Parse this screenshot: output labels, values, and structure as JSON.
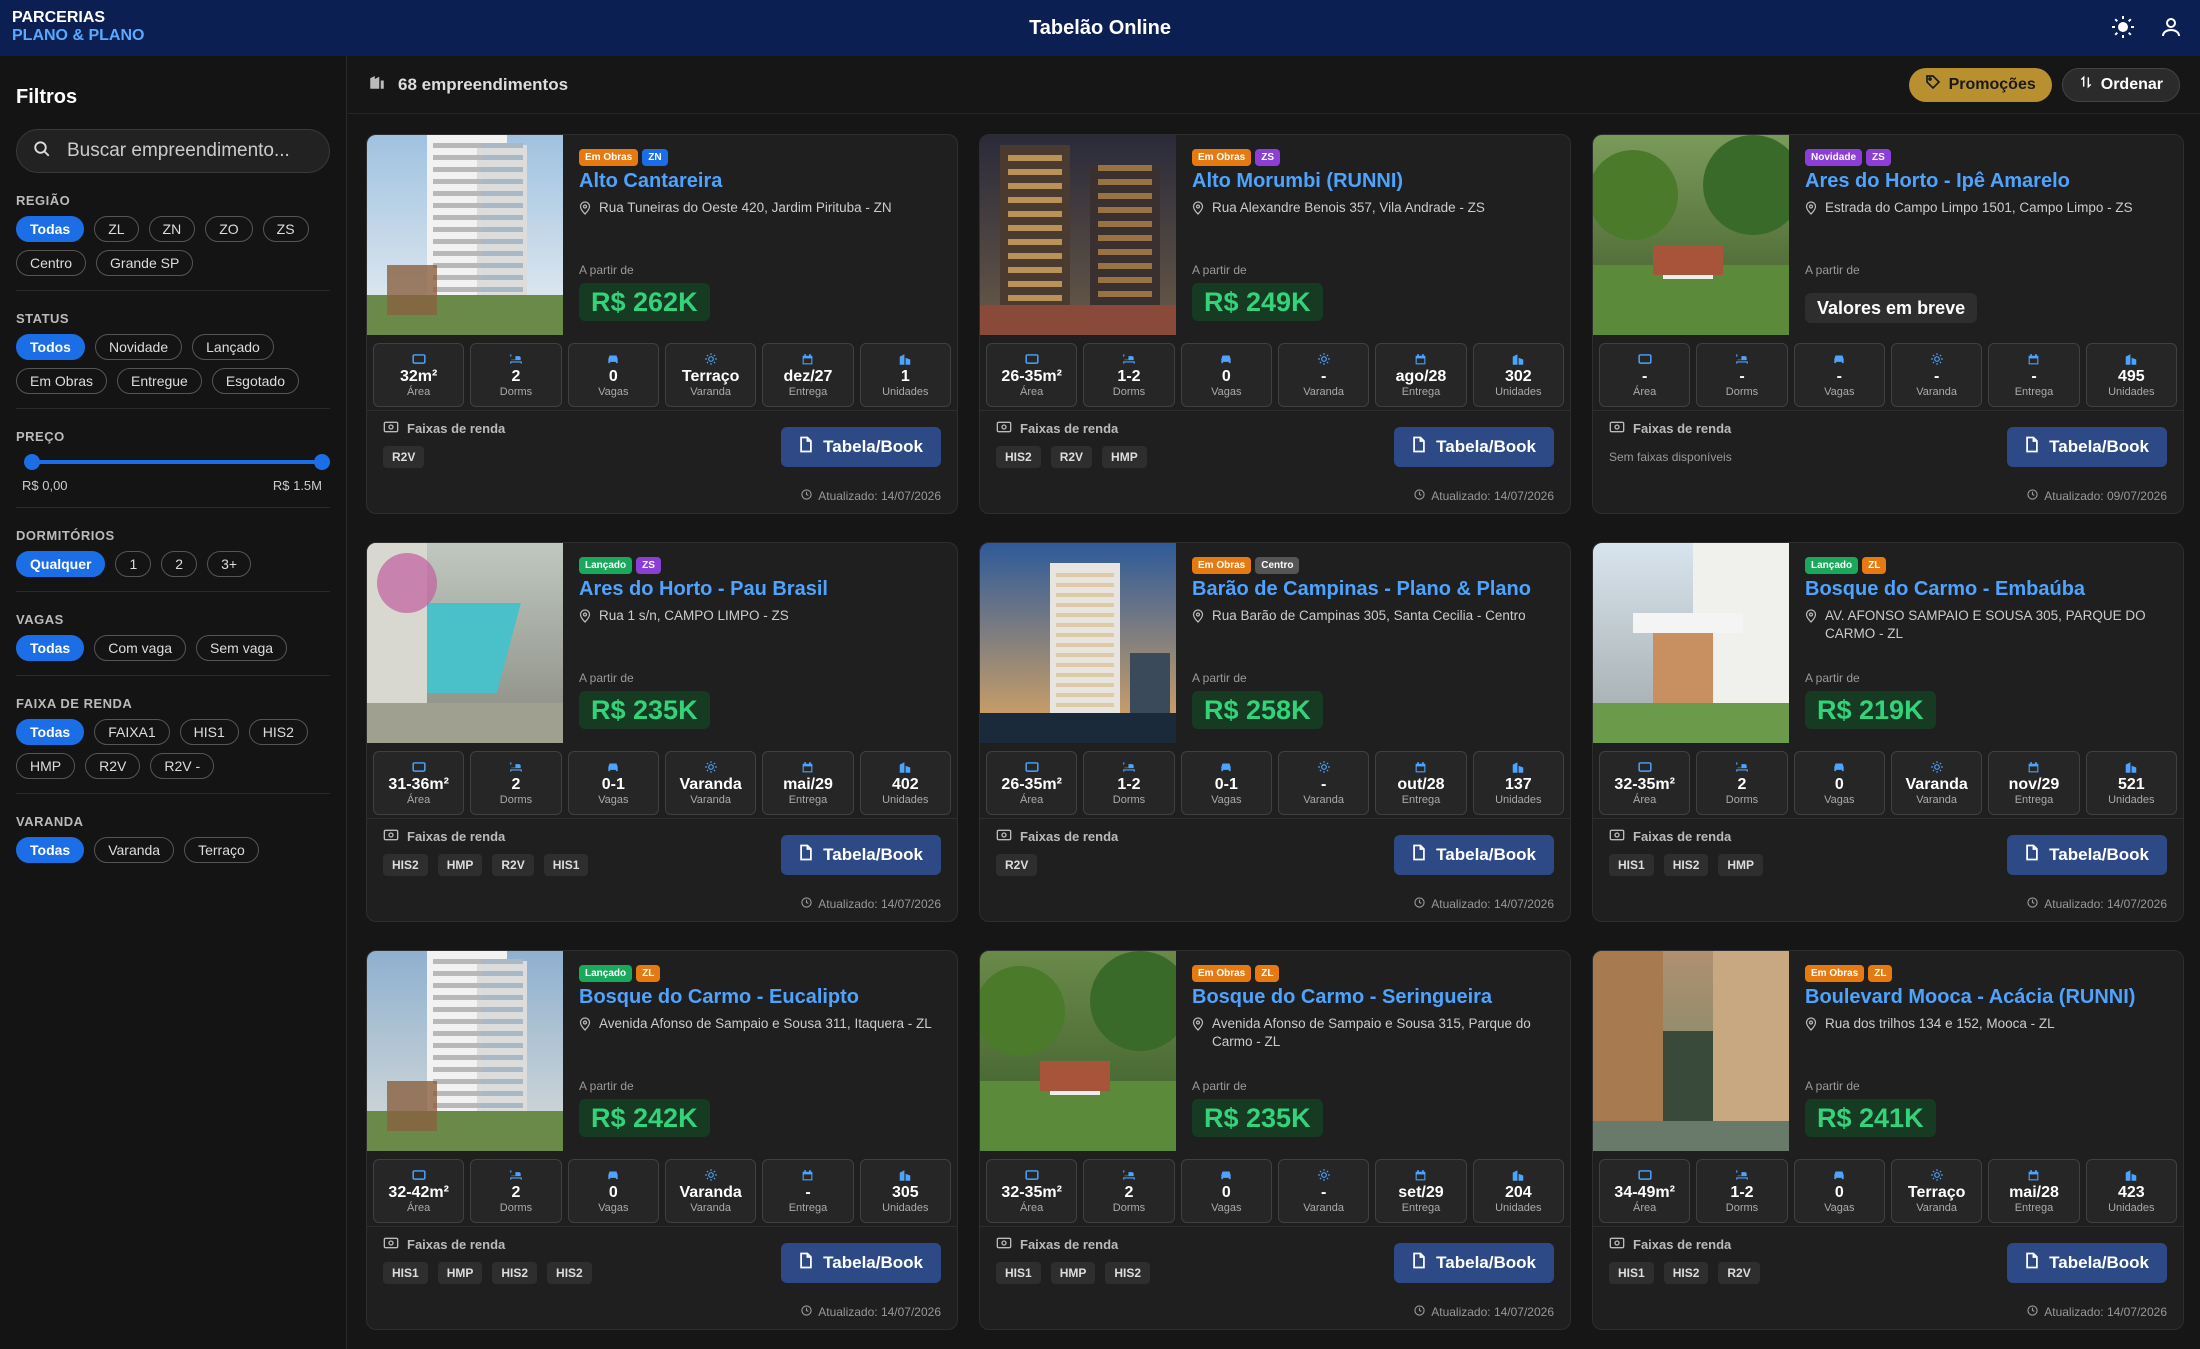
{
  "header": {
    "brand_line1": "PARCERIAS",
    "brand_line2": "PLANO & PLANO",
    "title": "Tabelão Online"
  },
  "sidebar": {
    "title": "Filtros",
    "search_placeholder": "Buscar empreendimento...",
    "groups": [
      {
        "label": "REGIÃO",
        "chips": [
          "Todas",
          "ZL",
          "ZN",
          "ZO",
          "ZS",
          "Centro",
          "Grande SP"
        ],
        "active": 0
      },
      {
        "label": "STATUS",
        "chips": [
          "Todos",
          "Novidade",
          "Lançado",
          "Em Obras",
          "Entregue",
          "Esgotado"
        ],
        "active": 0
      },
      {
        "label": "PREÇO",
        "min": "R$ 0,00",
        "max": "R$ 1.5M"
      },
      {
        "label": "DORMITÓRIOS",
        "chips": [
          "Qualquer",
          "1",
          "2",
          "3+"
        ],
        "active": 0
      },
      {
        "label": "VAGAS",
        "chips": [
          "Todas",
          "Com vaga",
          "Sem vaga"
        ],
        "active": 0
      },
      {
        "label": "FAIXA DE RENDA",
        "chips": [
          "Todas",
          "FAIXA1",
          "HIS1",
          "HIS2",
          "HMP",
          "R2V",
          "R2V -"
        ],
        "active": 0
      },
      {
        "label": "VARANDA",
        "chips": [
          "Todas",
          "Varanda",
          "Terraço"
        ],
        "active": 0
      }
    ]
  },
  "toolbar": {
    "count": "68 empreendimentos",
    "promo": "Promoções",
    "order": "Ordenar"
  },
  "labels": {
    "from": "A partir de",
    "faixas": "Faixas de renda",
    "book": "Tabela/Book",
    "area": "Área",
    "dorms": "Dorms",
    "vagas": "Vagas",
    "varanda": "Varanda",
    "entrega": "Entrega",
    "unidades": "Unidades"
  },
  "cards": [
    {
      "status": "Em Obras",
      "status_class": "t-obras",
      "region": "ZN",
      "region_class": "t-zn",
      "title": "Alto Cantareira",
      "address": "Rua Tuneiras do Oeste 420, Jardim Pirituba - ZN",
      "price": "R$ 262K",
      "area": "32m²",
      "dorms": "2",
      "vagas": "0",
      "varanda": "Terraço",
      "entrega": "dez/27",
      "unidades": "1",
      "faixas": [
        "R2V"
      ],
      "updated": "Atualizado: 14/07/2026",
      "photo": "tower"
    },
    {
      "status": "Em Obras",
      "status_class": "t-obras",
      "region": "ZS",
      "region_class": "t-zs",
      "title": "Alto Morumbi (RUNNI)",
      "address": "Rua Alexandre Benois 357, Vila Andrade - ZS",
      "price": "R$ 249K",
      "area": "26-35m²",
      "dorms": "1-2",
      "vagas": "0",
      "varanda": "-",
      "entrega": "ago/28",
      "unidades": "302",
      "faixas": [
        "HIS2",
        "R2V",
        "HMP"
      ],
      "updated": "Atualizado: 14/07/2026",
      "photo": "night"
    },
    {
      "status": "Novidade",
      "status_class": "t-nov",
      "region": "ZS",
      "region_class": "t-zs",
      "title": "Ares do Horto - Ipê Amarelo",
      "address": "Estrada do Campo Limpo 1501, Campo Limpo - ZS",
      "price": "Valores em breve",
      "soon": true,
      "area": "-",
      "dorms": "-",
      "vagas": "-",
      "varanda": "-",
      "entrega": "-",
      "unidades": "495",
      "faixas": [],
      "nofaixas": "Sem faixas disponíveis",
      "updated": "Atualizado: 09/07/2026",
      "photo": "garden"
    },
    {
      "status": "Lançado",
      "status_class": "t-lanc",
      "region": "ZS",
      "region_class": "t-zs",
      "title": "Ares do Horto - Pau Brasil",
      "address": "Rua 1 s/n, CAMPO LIMPO - ZS",
      "price": "R$ 235K",
      "area": "31-36m²",
      "dorms": "2",
      "vagas": "0-1",
      "varanda": "Varanda",
      "entrega": "mai/29",
      "unidades": "402",
      "faixas": [
        "HIS2",
        "HMP",
        "R2V",
        "HIS1"
      ],
      "updated": "Atualizado: 14/07/2026",
      "photo": "pool"
    },
    {
      "status": "Em Obras",
      "status_class": "t-obras",
      "region": "Centro",
      "region_class": "t-centro",
      "title": "Barão de Campinas - Plano & Plano",
      "address": "Rua Barão de Campinas 305, Santa Cecilia - Centro",
      "price": "R$ 258K",
      "area": "26-35m²",
      "dorms": "1-2",
      "vagas": "0-1",
      "varanda": "-",
      "entrega": "out/28",
      "unidades": "137",
      "faixas": [
        "R2V"
      ],
      "updated": "Atualizado: 14/07/2026",
      "photo": "dusk"
    },
    {
      "status": "Lançado",
      "status_class": "t-lanc",
      "region": "ZL",
      "region_class": "t-zl",
      "title": "Bosque do Carmo - Embaúba",
      "address": "AV. AFONSO SAMPAIO E SOUSA 305, PARQUE DO CARMO - ZL",
      "price": "R$ 219K",
      "area": "32-35m²",
      "dorms": "2",
      "vagas": "0",
      "varanda": "Varanda",
      "entrega": "nov/29",
      "unidades": "521",
      "faixas": [
        "HIS1",
        "HIS2",
        "HMP"
      ],
      "updated": "Atualizado: 14/07/2026",
      "photo": "entrance"
    },
    {
      "status": "Lançado",
      "status_class": "t-lanc",
      "region": "ZL",
      "region_class": "t-zl",
      "title": "Bosque do Carmo - Eucalipto",
      "address": "Avenida Afonso de Sampaio e Sousa 311, Itaquera - ZL",
      "price": "R$ 242K",
      "area": "32-42m²",
      "dorms": "2",
      "vagas": "0",
      "varanda": "Varanda",
      "entrega": "-",
      "unidades": "305",
      "faixas": [
        "HIS1",
        "HMP",
        "HIS2",
        "HIS2"
      ],
      "updated": "Atualizado: 14/07/2026",
      "photo": "tower2"
    },
    {
      "status": "Em Obras",
      "status_class": "t-obras",
      "region": "ZL",
      "region_class": "t-zl",
      "title": "Bosque do Carmo - Seringueira",
      "address": "Avenida Afonso de Sampaio e Sousa 315, Parque do Carmo - ZL",
      "price": "R$ 235K",
      "area": "32-35m²",
      "dorms": "2",
      "vagas": "0",
      "varanda": "-",
      "entrega": "set/29",
      "unidades": "204",
      "faixas": [
        "HIS1",
        "HMP",
        "HIS2"
      ],
      "updated": "Atualizado: 14/07/2026",
      "photo": "picnic"
    },
    {
      "status": "Em Obras",
      "status_class": "t-obras",
      "region": "ZL",
      "region_class": "t-zl",
      "title": "Boulevard Mooca - Acácia (RUNNI)",
      "address": "Rua dos trilhos 134 e 152, Mooca - ZL",
      "price": "R$ 241K",
      "area": "34-49m²",
      "dorms": "1-2",
      "vagas": "0",
      "varanda": "Terraço",
      "entrega": "mai/28",
      "unidades": "423",
      "faixas": [
        "HIS1",
        "HIS2",
        "R2V"
      ],
      "updated": "Atualizado: 14/07/2026",
      "photo": "courtyard"
    }
  ]
}
